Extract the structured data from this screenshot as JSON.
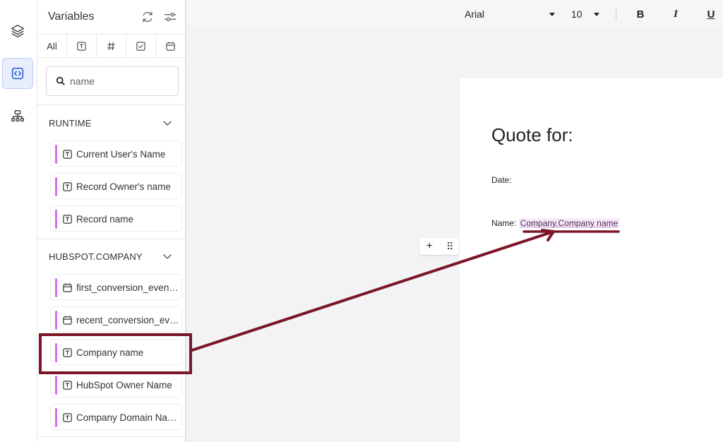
{
  "panel": {
    "title": "Variables",
    "tabs": [
      {
        "label": "All",
        "icon": "all"
      },
      {
        "label": "",
        "icon": "text-type-icon"
      },
      {
        "label": "",
        "icon": "number-hash-icon"
      },
      {
        "label": "",
        "icon": "checkbox-icon"
      },
      {
        "label": "",
        "icon": "calendar-icon"
      }
    ],
    "search": {
      "placeholder": "name",
      "value": ""
    },
    "groups": [
      {
        "title": "RUNTIME",
        "items": [
          {
            "label": "Current User's Name",
            "icon": "text-type-icon"
          },
          {
            "label": "Record Owner's name",
            "icon": "text-type-icon"
          },
          {
            "label": "Record name",
            "icon": "text-type-icon"
          }
        ]
      },
      {
        "title": "HUBSPOT.COMPANY",
        "items": [
          {
            "label": "first_conversion_event_name",
            "icon": "calendar-icon"
          },
          {
            "label": "recent_conversion_event_name",
            "icon": "calendar-icon"
          },
          {
            "label": "Company name",
            "icon": "text-type-icon"
          },
          {
            "label": "HubSpot Owner Name",
            "icon": "text-type-icon"
          },
          {
            "label": "Company Domain Name",
            "icon": "text-type-icon"
          }
        ]
      }
    ]
  },
  "toolbar": {
    "font": "Arial",
    "size": "10",
    "bold": "B",
    "italic": "I",
    "underline": "U"
  },
  "document": {
    "title": "Quote for:",
    "date_label": "Date:",
    "name_label": "Name:",
    "name_variable": "Company.Company name"
  },
  "colors": {
    "accent_bar": "#d56ef0",
    "annotation": "#7a1628",
    "active_rail": "#e8eefc"
  }
}
